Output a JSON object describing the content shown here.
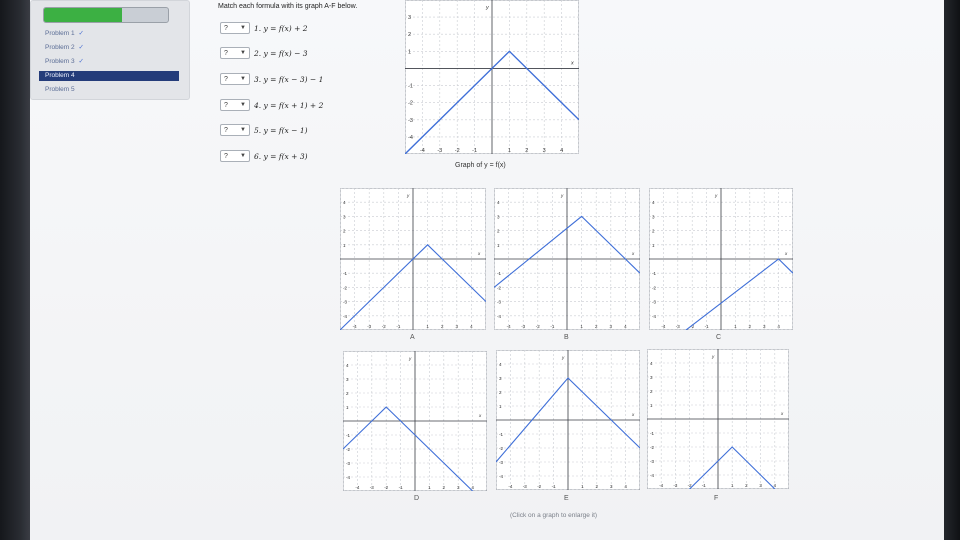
{
  "nav": {
    "progress_fraction": 0.63,
    "items": [
      {
        "label": "Problem 1",
        "done": true,
        "active": false
      },
      {
        "label": "Problem 2",
        "done": true,
        "active": false
      },
      {
        "label": "Problem 3",
        "done": true,
        "active": false
      },
      {
        "label": "Problem 4",
        "done": false,
        "active": true
      },
      {
        "label": "Problem 5",
        "done": false,
        "active": false
      }
    ],
    "check_glyph": "✓"
  },
  "instruction": "Match each formula with its graph A-F below.",
  "formulas": [
    {
      "select_value": "?",
      "text": "1. y = f(x) + 2"
    },
    {
      "select_value": "?",
      "text": "2. y = f(x) − 3"
    },
    {
      "select_value": "?",
      "text": "3. y = f(x − 3) − 1"
    },
    {
      "select_value": "?",
      "text": "4. y = f(x + 1) + 2"
    },
    {
      "select_value": "?",
      "text": "5. y = f(x − 1)"
    },
    {
      "select_value": "?",
      "text": "6. y = f(x + 3)"
    }
  ],
  "reference_graph": {
    "caption": "Graph of y = f(x)",
    "xlim": [
      -5,
      5
    ],
    "ylim": [
      -5,
      4
    ],
    "polyline": [
      [
        -5,
        -5
      ],
      [
        1,
        1
      ],
      [
        4,
        -2
      ],
      [
        5,
        -3
      ]
    ],
    "x_ticks": [
      "-4",
      "-3",
      "-2",
      "-1",
      "1",
      "2",
      "3",
      "4"
    ],
    "y_ticks": [
      "3",
      "2",
      "1",
      "-1",
      "-2",
      "-3",
      "-4"
    ],
    "x_axis_label": "x",
    "y_axis_label": "y"
  },
  "option_graphs": [
    {
      "letter": "A",
      "polyline": [
        [
          -5,
          -5
        ],
        [
          1,
          1
        ],
        [
          4,
          -2
        ],
        [
          5,
          -3
        ]
      ]
    },
    {
      "letter": "B",
      "polyline": [
        [
          -5,
          -2
        ],
        [
          1,
          3
        ],
        [
          4,
          0
        ],
        [
          5,
          -1
        ]
      ]
    },
    {
      "letter": "C",
      "polyline": [
        [
          -5,
          -7
        ],
        [
          4,
          0
        ],
        [
          5,
          -1
        ]
      ]
    },
    {
      "letter": "D",
      "polyline": [
        [
          -5,
          -2
        ],
        [
          -2,
          1
        ],
        [
          4,
          -5
        ],
        [
          5,
          -6
        ]
      ]
    },
    {
      "letter": "E",
      "polyline": [
        [
          -5,
          -3
        ],
        [
          0,
          3
        ],
        [
          4,
          -1
        ],
        [
          5,
          -2
        ]
      ]
    },
    {
      "letter": "F",
      "polyline": [
        [
          -5,
          -8
        ],
        [
          1,
          -2
        ],
        [
          4,
          -5
        ],
        [
          5,
          -6
        ]
      ]
    }
  ],
  "option_axes": {
    "xlim": [
      -5,
      5
    ],
    "ylim": [
      -5,
      5
    ],
    "x_ticks": [
      "-4",
      "-3",
      "-2",
      "-1",
      "1",
      "2",
      "3",
      "4"
    ],
    "y_ticks": [
      "4",
      "3",
      "2",
      "1",
      "-1",
      "-2",
      "-3",
      "-4"
    ],
    "x_axis_label": "x",
    "y_axis_label": "y"
  },
  "footer": "(Click on a graph to enlarge it)",
  "colors": {
    "curve": "#3f6fd8",
    "grid": "#c9ccd2",
    "axis": "#3a3d44",
    "progress": "#3cb043",
    "nav_active": "#243c7a"
  }
}
